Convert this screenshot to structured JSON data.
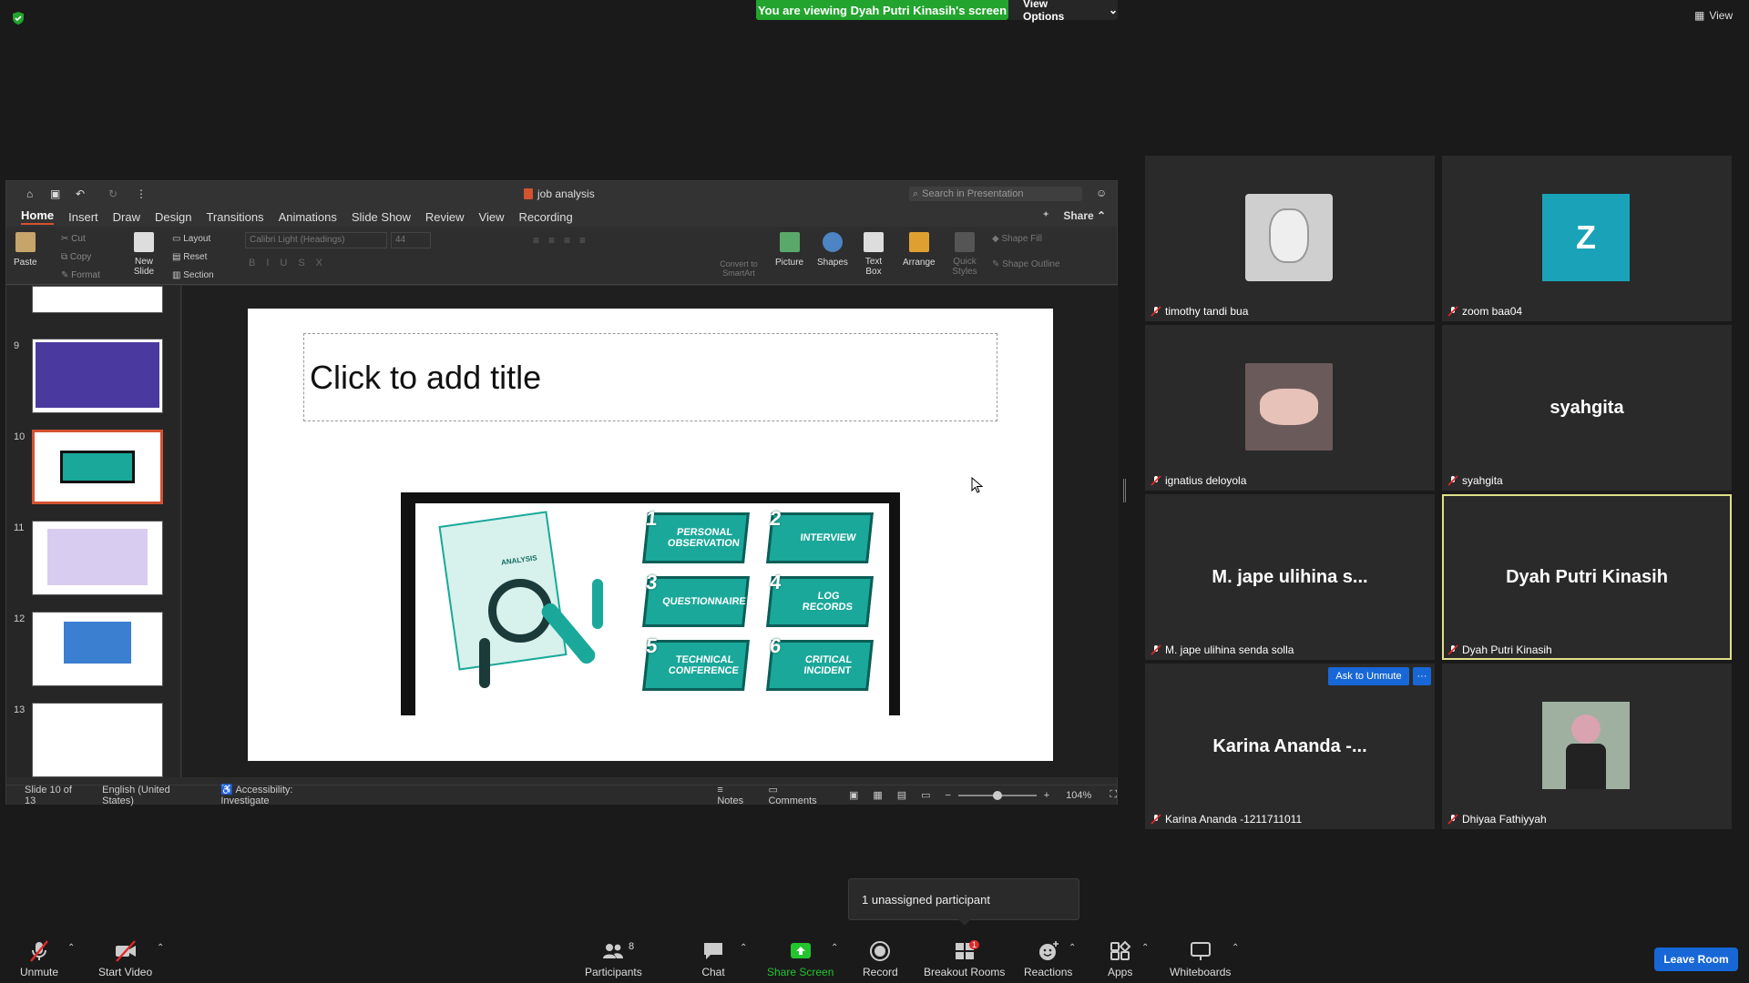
{
  "banner": {
    "viewing": "You are viewing Dyah Putri Kinasih's screen",
    "view_options": "View Options",
    "view": "View"
  },
  "ppt": {
    "title": "job analysis",
    "search_placeholder": "Search in Presentation",
    "share": "Share",
    "tabs": [
      "Home",
      "Insert",
      "Draw",
      "Design",
      "Transitions",
      "Animations",
      "Slide Show",
      "Review",
      "View",
      "Recording"
    ],
    "ribbon": {
      "paste": "Paste",
      "cut": "Cut",
      "copy": "Copy",
      "format": "Format",
      "new_slide": "New Slide",
      "layout": "Layout",
      "reset": "Reset",
      "section": "Section",
      "font": "Calibri Light (Headings)",
      "font_size": "44",
      "convert": "Convert to SmartArt",
      "picture": "Picture",
      "shapes": "Shapes",
      "text_box": "Text Box",
      "arrange": "Arrange",
      "quick_styles": "Quick Styles",
      "shape_fill": "Shape Fill",
      "shape_outline": "Shape Outline"
    },
    "thumb_numbers": [
      "9",
      "10",
      "11",
      "12",
      "13"
    ],
    "slide_title_placeholder": "Click to add title",
    "image_steps": [
      {
        "n": "1",
        "label": "PERSONAL OBSERVATION"
      },
      {
        "n": "2",
        "label": "INTERVIEW"
      },
      {
        "n": "3",
        "label": "QUESTIONNAIRE"
      },
      {
        "n": "4",
        "label": "LOG RECORDS"
      },
      {
        "n": "5",
        "label": "TECHNICAL CONFERENCE"
      },
      {
        "n": "6",
        "label": "CRITICAL INCIDENT"
      }
    ],
    "image_analysis_text": "ANALYSIS",
    "status": {
      "slide": "Slide 10 of 13",
      "language": "English (United States)",
      "accessibility": "Accessibility: Investigate",
      "notes": "Notes",
      "comments": "Comments",
      "zoom": "104%"
    }
  },
  "participants": [
    {
      "name": "timothy tandi bua",
      "display": "",
      "kind": "photo-statue"
    },
    {
      "name": "zoom baa04",
      "display": "Z",
      "kind": "avatar-z"
    },
    {
      "name": "ignatius deloyola",
      "display": "",
      "kind": "photo-baby"
    },
    {
      "name": "syahgita",
      "display": "syahgita",
      "kind": "name"
    },
    {
      "name": "M. jape ulihina senda solla",
      "display": "M. jape ulihina s...",
      "kind": "name"
    },
    {
      "name": "Dyah Putri Kinasih",
      "display": "Dyah Putri Kinasih",
      "kind": "name"
    },
    {
      "name": "Karina Ananda -1211711011",
      "display": "Karina Ananda -...",
      "kind": "name"
    },
    {
      "name": "Dhiyaa Fathiyyah",
      "display": "",
      "kind": "photo-person"
    }
  ],
  "ask_to_unmute": "Ask to Unmute",
  "more": "···",
  "unassigned": "1 unassigned participant",
  "toolbar": {
    "unmute": "Unmute",
    "start_video": "Start Video",
    "participants": "Participants",
    "participants_count": "8",
    "chat": "Chat",
    "share_screen": "Share Screen",
    "record": "Record",
    "breakout": "Breakout Rooms",
    "breakout_badge": "1",
    "reactions": "Reactions",
    "apps": "Apps",
    "whiteboards": "Whiteboards",
    "leave": "Leave Room"
  },
  "colors": {
    "green": "#23a42e",
    "blue": "#1867d6",
    "accent": "#d35230",
    "teal": "#1aa89a",
    "zoom_z": "#1aa3b8"
  }
}
